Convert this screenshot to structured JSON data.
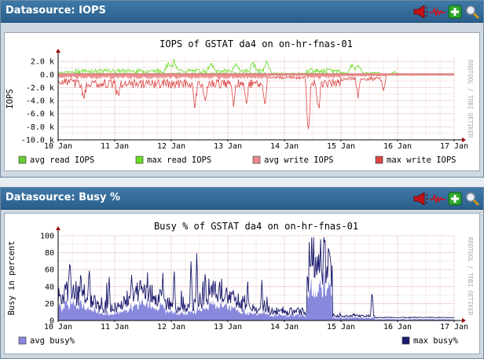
{
  "panels": [
    {
      "header": "Datasource: IOPS",
      "chart_data": {
        "type": "line",
        "title": "IOPS of GSTAT da4 on on-hr-fnas-01",
        "ylabel": "IOPS",
        "xlabel": "",
        "watermark": "RRDTOOL / TOBI OETIKER",
        "x_ticks": [
          "10 Jan",
          "11 Jan",
          "12 Jan",
          "13 Jan",
          "14 Jan",
          "15 Jan",
          "16 Jan",
          "17 Jan"
        ],
        "y_ticks": [
          "2.0 k",
          "0.0",
          "-2.0 k",
          "-4.0 k",
          "-6.0 k",
          "-8.0 k",
          "-10.0 k"
        ],
        "y_tick_values": [
          2000,
          0,
          -2000,
          -4000,
          -6000,
          -8000,
          -10000
        ],
        "ylim": [
          -10000,
          2500
        ],
        "grid": true,
        "legend_position": "bottom",
        "series": [
          {
            "name": "avg read IOPS",
            "color": "#66cc33"
          },
          {
            "name": "max read IOPS",
            "color": "#66dd22"
          },
          {
            "name": "avg write IOPS",
            "color": "#ee8888"
          },
          {
            "name": "max write IOPS",
            "color": "#dd4444"
          }
        ]
      }
    },
    {
      "header": "Datasource: Busy %",
      "chart_data": {
        "type": "area",
        "title": "Busy % of GSTAT da4 on on-hr-fnas-01",
        "ylabel": "Busy in percent",
        "xlabel": "",
        "watermark": "RRDTOOL / TOBI OETIKER",
        "x_ticks": [
          "10 Jan",
          "11 Jan",
          "12 Jan",
          "13 Jan",
          "14 Jan",
          "15 Jan",
          "16 Jan",
          "17 Jan"
        ],
        "y_ticks": [
          "100",
          "80",
          "60",
          "40",
          "20",
          "0"
        ],
        "y_tick_values": [
          100,
          80,
          60,
          40,
          20,
          0
        ],
        "ylim": [
          0,
          100
        ],
        "grid": true,
        "legend_position": "bottom",
        "series": [
          {
            "name": "avg busy%",
            "color": "#8888dd"
          },
          {
            "name": "max busy%",
            "color": "#1a1a6e"
          }
        ]
      }
    }
  ],
  "icons": [
    "alert-horn-icon",
    "sparkline-icon",
    "add-icon",
    "zoom-icon"
  ]
}
